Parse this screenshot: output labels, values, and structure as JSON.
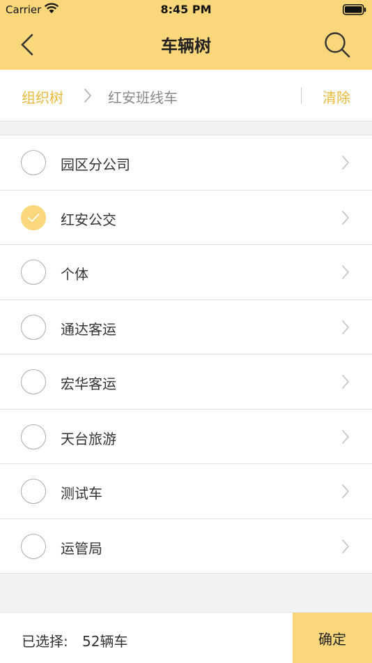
{
  "status_bar": {
    "carrier": "Carrier",
    "time": "8:45 PM",
    "wifi_icon": "wifi-icon",
    "battery_icon": "battery-icon"
  },
  "nav": {
    "title": "车辆树",
    "back_icon": "chevron-left-icon",
    "search_icon": "search-icon"
  },
  "breadcrumb": {
    "root": "组织树",
    "current": "红安班线车",
    "clear": "清除"
  },
  "items": [
    {
      "label": "园区分公司",
      "checked": false
    },
    {
      "label": "红安公交",
      "checked": true
    },
    {
      "label": "个体",
      "checked": false
    },
    {
      "label": "通达客运",
      "checked": false
    },
    {
      "label": "宏华客运",
      "checked": false
    },
    {
      "label": "天台旅游",
      "checked": false
    },
    {
      "label": "测试车",
      "checked": false
    },
    {
      "label": "运管局",
      "checked": false
    }
  ],
  "footer": {
    "selected_label": "已选择:",
    "selected_count": "52辆车",
    "confirm": "确定"
  },
  "colors": {
    "accent": "#fad77b",
    "link": "#e9b93c"
  }
}
